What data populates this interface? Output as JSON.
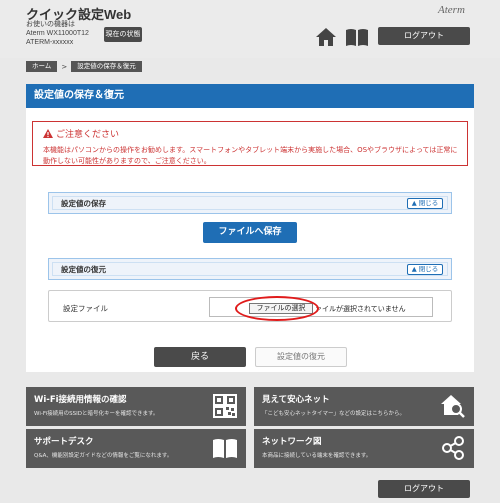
{
  "header": {
    "app_title": "クイック設定Web",
    "device_caption": "お使いの機器は",
    "device_model": "Aterm WX11000T12",
    "device_id": "ATERM-xxxxxx",
    "status_button": "現在の状態",
    "brand": "Aterm",
    "logout_label": "ログアウト"
  },
  "breadcrumb": {
    "home": "ホーム",
    "separator": ">",
    "current": "設定値の保存＆復元"
  },
  "page_title": "設定値の保存＆復元",
  "caution": {
    "title": "ご注意ください",
    "body": "本機能はパソコンからの操作をお勧めします。スマートフォンやタブレット端末から実施した場合、OSやブラウザによっては正常に動作しない可能性がありますので、ご注意ください。"
  },
  "save_panel": {
    "label": "設定値の保存",
    "close_label": "閉じる",
    "save_button": "ファイルへ保存"
  },
  "restore_panel": {
    "label": "設定値の復元",
    "close_label": "閉じる",
    "file_label": "設定ファイル",
    "choose_button": "ファイルの選択",
    "no_file_text": "ァイルが選択されていません"
  },
  "actions": {
    "back": "戻る",
    "restore": "設定値の復元"
  },
  "tiles": [
    {
      "title": "Wi-Fi接続用情報の確認",
      "desc": "Wi-Fi接続用のSSIDと暗号化キーを確認できます。",
      "icon": "qr-code-icon"
    },
    {
      "title": "見えて安心ネット",
      "desc": "「こども安心ネットタイマー」などの設定はこちらから。",
      "icon": "home-search-icon"
    },
    {
      "title": "サポートデスク",
      "desc": "Q&A、機能別設定ガイドなどの情報をご覧になれます。",
      "icon": "book-icon"
    },
    {
      "title": "ネットワーク図",
      "desc": "本商品に接続している端末を確認できます。",
      "icon": "network-icon"
    }
  ],
  "footer": {
    "logout_label": "ログアウト"
  },
  "colors": {
    "primary_blue": "#1f6eb5",
    "warning_red": "#cc3333",
    "dark_button": "#4a4a4a",
    "highlight_red": "#e01b1b"
  }
}
